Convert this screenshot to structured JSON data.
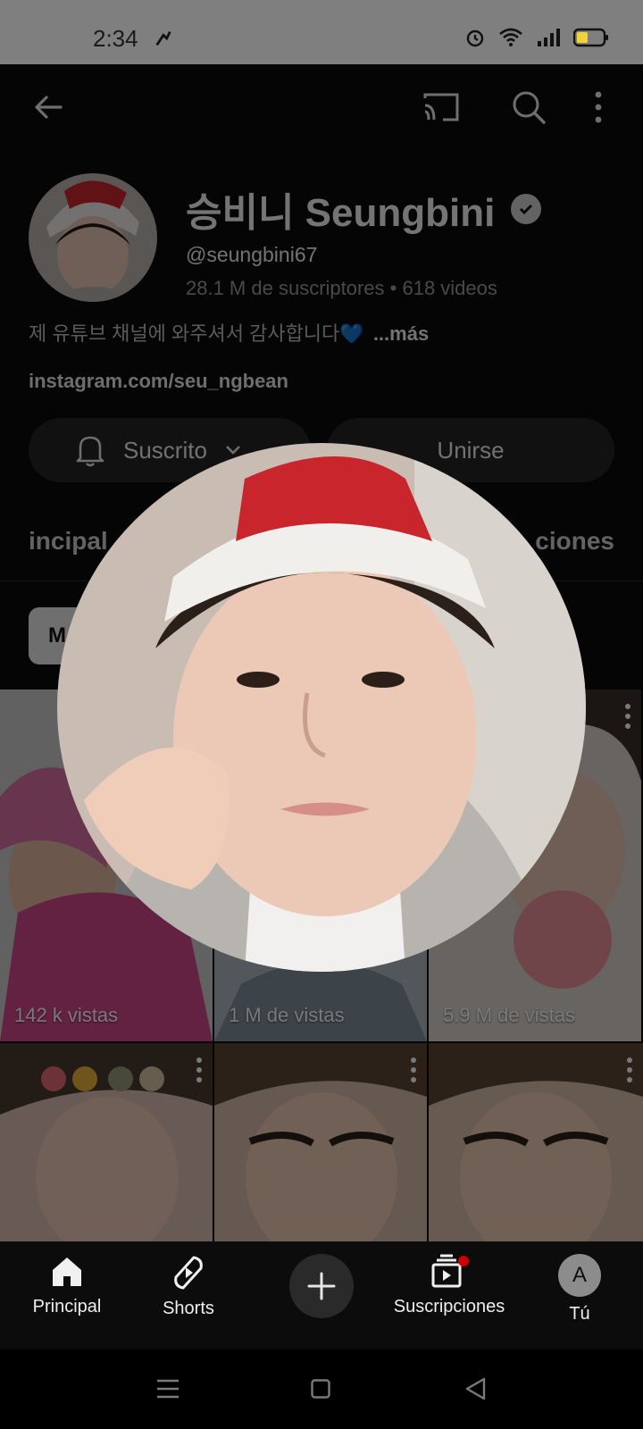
{
  "status_bar": {
    "time": "2:34"
  },
  "channel": {
    "name": "승비니 Seungbini",
    "handle": "@seungbini67",
    "stats": "28.1 M de suscriptores • 618 videos",
    "description": "제 유튜브 채널에 와주셔서 감사합니다💙",
    "more_label": "...más",
    "link": "instagram.com/seu_ngbean"
  },
  "actions": {
    "subscribe_label": "Suscrito",
    "join_label": "Unirse"
  },
  "tabs": {
    "left_partial": "incipal",
    "right_partial": "ciones"
  },
  "chip": {
    "label": "M"
  },
  "videos": [
    {
      "views": "142 k vistas"
    },
    {
      "views": "1 M de vistas"
    },
    {
      "views": "5.9 M de vistas"
    },
    {
      "views": ""
    },
    {
      "views": ""
    },
    {
      "views": ""
    }
  ],
  "bottom_nav": {
    "home": "Principal",
    "shorts": "Shorts",
    "subscriptions": "Suscripciones",
    "you": "Tú",
    "you_initial": "A"
  },
  "colors": {
    "accent_red": "#cc0000",
    "bg": "#0b0b0b"
  },
  "icons": [
    "back-arrow-icon",
    "cast-icon",
    "search-icon",
    "more-vert-icon",
    "bell-icon",
    "chevron-down-icon",
    "home-icon",
    "shorts-icon",
    "plus-icon",
    "subscriptions-icon",
    "menu-icon",
    "square-icon",
    "triangle-back-icon",
    "verified-icon",
    "alarm-icon",
    "wifi-icon",
    "signal-icon",
    "battery-icon"
  ]
}
